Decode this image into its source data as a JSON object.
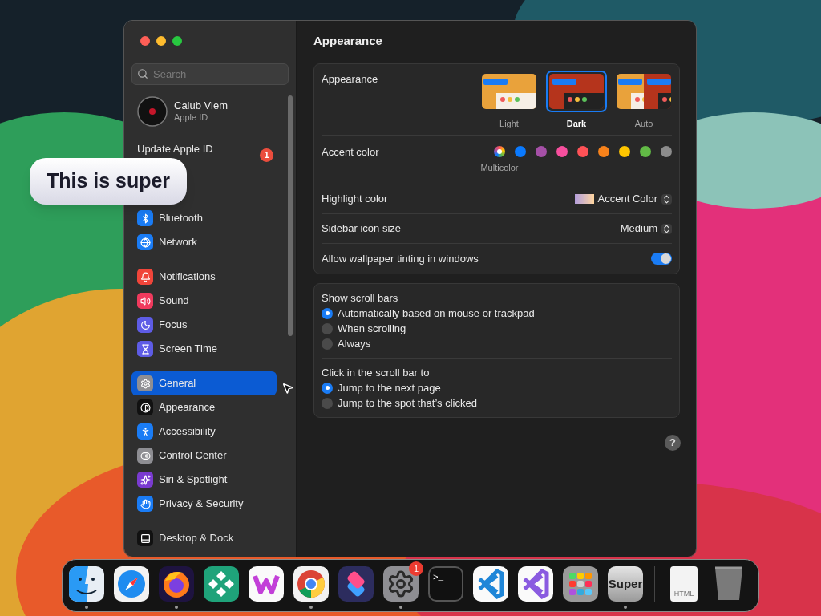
{
  "caption": "This is super",
  "sidebar": {
    "search": {
      "placeholder": "Search"
    },
    "profile": {
      "name": "Calub Viem",
      "subtitle": "Apple ID"
    },
    "notice": {
      "label": "Update Apple ID",
      "badge": "1"
    },
    "groups": [
      {
        "items": [
          {
            "label": "Bluetooth",
            "color": "#1a7cf5",
            "selected": false
          },
          {
            "label": "Network",
            "color": "#1a7cf5",
            "selected": false
          }
        ]
      },
      {
        "items": [
          {
            "label": "Notifications",
            "color": "#f0453a",
            "selected": false
          },
          {
            "label": "Sound",
            "color": "#ef3a5d",
            "selected": false
          },
          {
            "label": "Focus",
            "color": "#5e5ce6",
            "selected": false
          },
          {
            "label": "Screen Time",
            "color": "#5e5ce6",
            "selected": false
          }
        ]
      },
      {
        "items": [
          {
            "label": "General",
            "color": "#8e8e93",
            "selected": true
          },
          {
            "label": "Appearance",
            "color": "#111111",
            "selected": false
          },
          {
            "label": "Accessibility",
            "color": "#1a7cf5",
            "selected": false
          },
          {
            "label": "Control Center",
            "color": "#8e8e93",
            "selected": false
          },
          {
            "label": "Siri & Spotlight",
            "color": "#7a3bd0",
            "selected": false
          },
          {
            "label": "Privacy & Security",
            "color": "#1a7cf5",
            "selected": false
          }
        ]
      },
      {
        "items": [
          {
            "label": "Desktop & Dock",
            "color": "#111111",
            "selected": false
          }
        ]
      }
    ]
  },
  "content": {
    "title": "Appearance",
    "appearance": {
      "label": "Appearance",
      "options": [
        {
          "label": "Light",
          "kind": "light",
          "selected": false
        },
        {
          "label": "Dark",
          "kind": "dark",
          "selected": true
        },
        {
          "label": "Auto",
          "kind": "auto",
          "selected": false
        }
      ]
    },
    "accent": {
      "label": "Accent color",
      "selected_name": "Multicolor",
      "swatches": [
        {
          "kind": "multicolor",
          "selected": true
        },
        {
          "kind": "solid",
          "color": "#0a7aff",
          "selected": false
        },
        {
          "kind": "solid",
          "color": "#a550a7",
          "selected": false
        },
        {
          "kind": "solid",
          "color": "#f74f9e",
          "selected": false
        },
        {
          "kind": "solid",
          "color": "#ff5257",
          "selected": false
        },
        {
          "kind": "solid",
          "color": "#f7821b",
          "selected": false
        },
        {
          "kind": "solid",
          "color": "#ffc600",
          "selected": false
        },
        {
          "kind": "solid",
          "color": "#62ba46",
          "selected": false
        },
        {
          "kind": "solid",
          "color": "#8c8c8c",
          "selected": false
        }
      ]
    },
    "highlight": {
      "label": "Highlight color",
      "value": "Accent Color"
    },
    "icon_size": {
      "label": "Sidebar icon size",
      "value": "Medium"
    },
    "tinting": {
      "label": "Allow wallpaper tinting in windows",
      "on": true
    },
    "scroll_groups": [
      {
        "label": "Show scroll bars",
        "options": [
          {
            "label": "Automatically based on mouse or trackpad",
            "selected": true
          },
          {
            "label": "When scrolling",
            "selected": false
          },
          {
            "label": "Always",
            "selected": false
          }
        ]
      },
      {
        "label": "Click in the scroll bar to",
        "options": [
          {
            "label": "Jump to the next page",
            "selected": true
          },
          {
            "label": "Jump to the spot that’s clicked",
            "selected": false
          }
        ]
      }
    ],
    "help": "?"
  },
  "dock": {
    "apps": [
      {
        "kind": "finder",
        "running": true
      },
      {
        "kind": "safari",
        "running": false
      },
      {
        "kind": "firefox",
        "running": true
      },
      {
        "kind": "diamonds",
        "running": false
      },
      {
        "kind": "wapp",
        "running": false
      },
      {
        "kind": "chrome",
        "running": true
      },
      {
        "kind": "shortcuts",
        "running": false
      },
      {
        "kind": "settings",
        "running": true,
        "badge": "1"
      },
      {
        "kind": "terminal",
        "running": false,
        "text": ">_"
      },
      {
        "kind": "vscode",
        "running": false
      },
      {
        "kind": "vstudio",
        "running": false
      },
      {
        "kind": "launchpad",
        "running": false
      },
      {
        "kind": "super",
        "running": true,
        "text": "Super"
      }
    ],
    "others": [
      {
        "kind": "file",
        "text": "HTML"
      },
      {
        "kind": "trash"
      }
    ]
  }
}
